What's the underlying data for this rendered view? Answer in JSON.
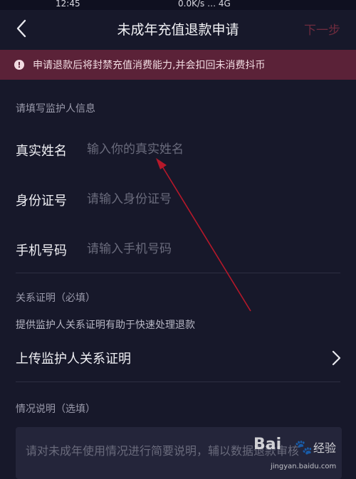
{
  "status_bar": {
    "left": "12:45",
    "right": "0.0K/s … 4G"
  },
  "header": {
    "title": "未成年充值退款申请",
    "next_label": "下一步"
  },
  "notice": {
    "text": "申请退款后将封禁充值消费能力,并会扣回未消费抖币"
  },
  "guardian_section": {
    "label": "请填写监护人信息",
    "fields": [
      {
        "label": "真实姓名",
        "placeholder": "输入你的真实姓名",
        "value": ""
      },
      {
        "label": "身份证号",
        "placeholder": "请输入身份证号",
        "value": ""
      },
      {
        "label": "手机号码",
        "placeholder": "请输入手机号码",
        "value": ""
      }
    ]
  },
  "relation_section": {
    "label": "关系证明（必填）",
    "hint": "提供监护人关系证明有助于快速处理退款",
    "upload_label": "上传监护人关系证明"
  },
  "description_section": {
    "label": "情况说明（选填）",
    "placeholder": "请对未成年使用情况进行简要说明，辅以数据退款审核"
  },
  "watermark": {
    "brand": "Bai",
    "brand_cn": "经验",
    "url": "jingyan.baidu.com"
  },
  "colors": {
    "background": "#17182a",
    "notice_bg": "#5b2238",
    "accent": "#6e2b3e",
    "arrow": "#b5182a"
  },
  "icons": {
    "back": "chevron-left-icon",
    "notice": "exclamation-circle-icon",
    "upload": "chevron-right-icon"
  }
}
